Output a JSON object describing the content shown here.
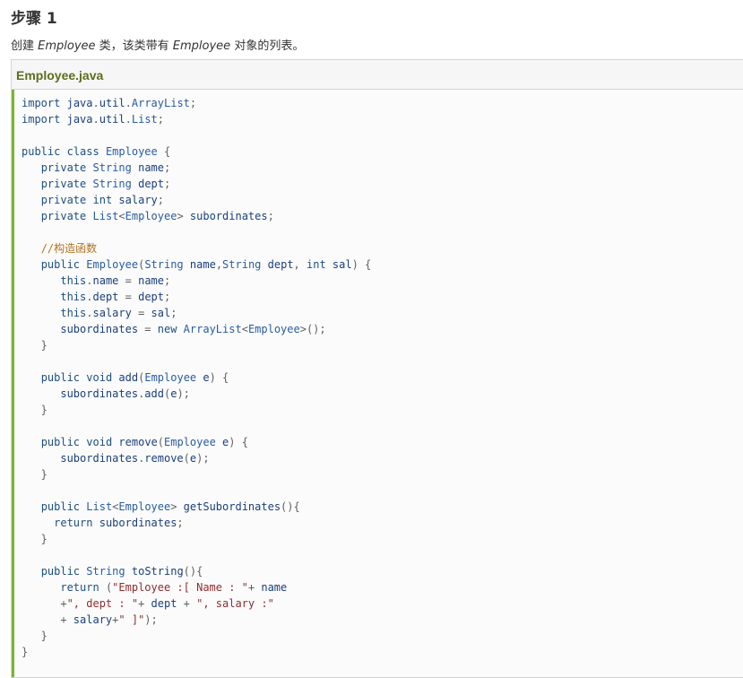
{
  "page": {
    "heading": "步骤 1",
    "intro_prefix": "创建 ",
    "intro_class1": "Employee",
    "intro_middle": " 类，该类带有 ",
    "intro_class2": "Employee",
    "intro_suffix": " 对象的列表。"
  },
  "code_block": {
    "filename": "Employee.java",
    "lines": [
      "import java.util.ArrayList;",
      "import java.util.List;",
      "",
      "public class Employee {",
      "   private String name;",
      "   private String dept;",
      "   private int salary;",
      "   private List<Employee> subordinates;",
      "",
      "   //构造函数",
      "   public Employee(String name,String dept, int sal) {",
      "      this.name = name;",
      "      this.dept = dept;",
      "      this.salary = sal;",
      "      subordinates = new ArrayList<Employee>();",
      "   }",
      "",
      "   public void add(Employee e) {",
      "      subordinates.add(e);",
      "   }",
      "",
      "   public void remove(Employee e) {",
      "      subordinates.remove(e);",
      "   }",
      "",
      "   public List<Employee> getSubordinates(){",
      "     return subordinates;",
      "   }",
      "",
      "   public String toString(){",
      "      return (\"Employee :[ Name : \"+ name",
      "      +\", dept : \"+ dept + \", salary :\"",
      "      + salary+\" ]\");",
      "   }",
      "}"
    ]
  },
  "colors": {
    "accent_bar": "#7ab531",
    "filename_text": "#5b6e1e",
    "keyword": "#1c4f80",
    "comment": "#b1701e",
    "string": "#8e2d2d"
  }
}
